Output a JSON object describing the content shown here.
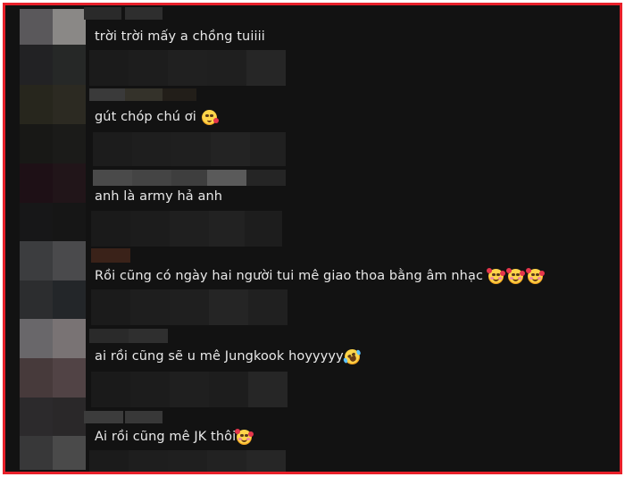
{
  "frame": {
    "border_color": "#e8202a",
    "background": "#121212"
  },
  "comments": [
    {
      "text": "trời trời mấy a chồng tuiiii",
      "emojis": []
    },
    {
      "text": "gút chóp chú ơi",
      "emojis": [
        "face-blowing-kiss-icon"
      ]
    },
    {
      "text": "anh là army hả anh",
      "emojis": []
    },
    {
      "text": "Rồi cũng có ngày hai người tui mê giao thoa bằng âm nhạc",
      "emojis": [
        "smiling-face-with-hearts-icon",
        "smiling-face-with-hearts-icon",
        "smiling-face-with-hearts-icon"
      ]
    },
    {
      "text": "ai rồi cũng sẽ u mê Jungkook hoyyyyy",
      "emojis": [
        "rolling-on-floor-laughing-icon"
      ]
    },
    {
      "text": "Ai rồi cũng mê JK thôi",
      "emojis": [
        "smiling-face-with-hearts-icon"
      ]
    }
  ]
}
